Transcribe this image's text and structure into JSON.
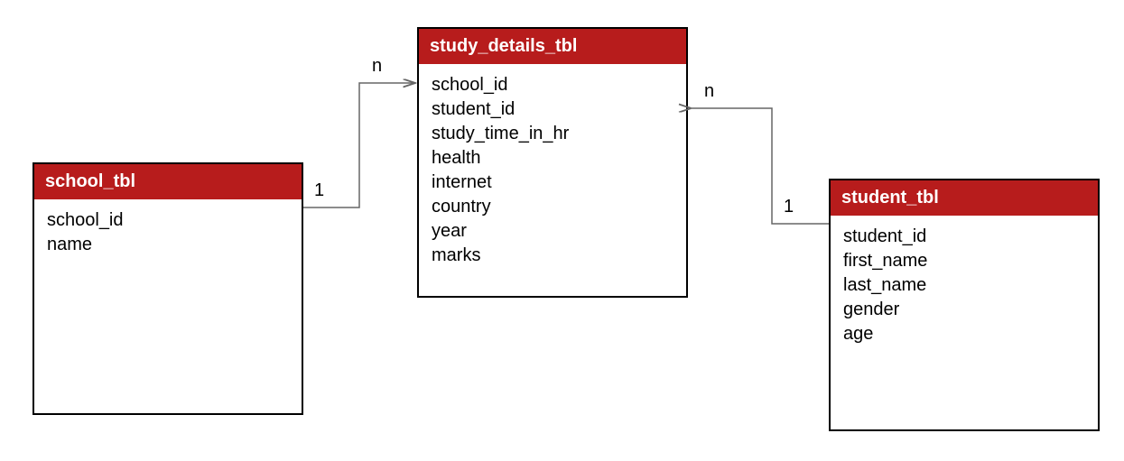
{
  "tables": {
    "school": {
      "title": "school_tbl",
      "fields": [
        "school_id",
        "name"
      ]
    },
    "study_details": {
      "title": "study_details_tbl",
      "fields": [
        "school_id",
        "student_id",
        "study_time_in_hr",
        "health",
        "internet",
        "country",
        "year",
        "marks"
      ]
    },
    "student": {
      "title": "student_tbl",
      "fields": [
        "student_id",
        "first_name",
        "last_name",
        "gender",
        "age"
      ]
    }
  },
  "relations": {
    "school_to_study": {
      "from_card": "1",
      "to_card": "n"
    },
    "student_to_study": {
      "from_card": "1",
      "to_card": "n"
    }
  }
}
